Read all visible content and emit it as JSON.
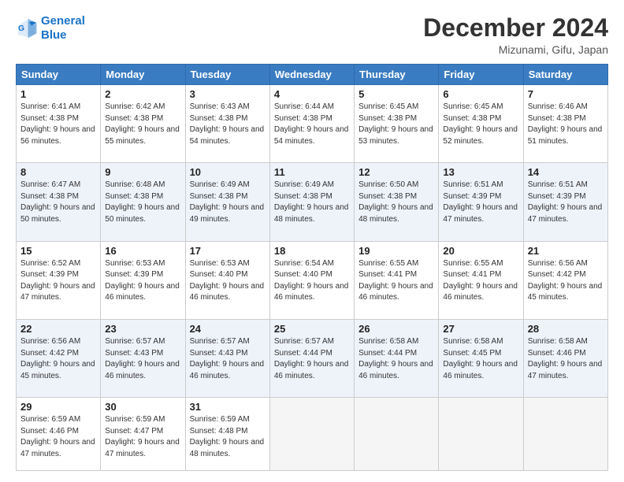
{
  "header": {
    "logo_line1": "General",
    "logo_line2": "Blue",
    "month_title": "December 2024",
    "location": "Mizunami, Gifu, Japan"
  },
  "weekdays": [
    "Sunday",
    "Monday",
    "Tuesday",
    "Wednesday",
    "Thursday",
    "Friday",
    "Saturday"
  ],
  "weeks": [
    [
      {
        "day": "1",
        "sunrise": "6:41 AM",
        "sunset": "4:38 PM",
        "daylight": "9 hours and 56 minutes."
      },
      {
        "day": "2",
        "sunrise": "6:42 AM",
        "sunset": "4:38 PM",
        "daylight": "9 hours and 55 minutes."
      },
      {
        "day": "3",
        "sunrise": "6:43 AM",
        "sunset": "4:38 PM",
        "daylight": "9 hours and 54 minutes."
      },
      {
        "day": "4",
        "sunrise": "6:44 AM",
        "sunset": "4:38 PM",
        "daylight": "9 hours and 54 minutes."
      },
      {
        "day": "5",
        "sunrise": "6:45 AM",
        "sunset": "4:38 PM",
        "daylight": "9 hours and 53 minutes."
      },
      {
        "day": "6",
        "sunrise": "6:45 AM",
        "sunset": "4:38 PM",
        "daylight": "9 hours and 52 minutes."
      },
      {
        "day": "7",
        "sunrise": "6:46 AM",
        "sunset": "4:38 PM",
        "daylight": "9 hours and 51 minutes."
      }
    ],
    [
      {
        "day": "8",
        "sunrise": "6:47 AM",
        "sunset": "4:38 PM",
        "daylight": "9 hours and 50 minutes."
      },
      {
        "day": "9",
        "sunrise": "6:48 AM",
        "sunset": "4:38 PM",
        "daylight": "9 hours and 50 minutes."
      },
      {
        "day": "10",
        "sunrise": "6:49 AM",
        "sunset": "4:38 PM",
        "daylight": "9 hours and 49 minutes."
      },
      {
        "day": "11",
        "sunrise": "6:49 AM",
        "sunset": "4:38 PM",
        "daylight": "9 hours and 48 minutes."
      },
      {
        "day": "12",
        "sunrise": "6:50 AM",
        "sunset": "4:38 PM",
        "daylight": "9 hours and 48 minutes."
      },
      {
        "day": "13",
        "sunrise": "6:51 AM",
        "sunset": "4:39 PM",
        "daylight": "9 hours and 47 minutes."
      },
      {
        "day": "14",
        "sunrise": "6:51 AM",
        "sunset": "4:39 PM",
        "daylight": "9 hours and 47 minutes."
      }
    ],
    [
      {
        "day": "15",
        "sunrise": "6:52 AM",
        "sunset": "4:39 PM",
        "daylight": "9 hours and 47 minutes."
      },
      {
        "day": "16",
        "sunrise": "6:53 AM",
        "sunset": "4:39 PM",
        "daylight": "9 hours and 46 minutes."
      },
      {
        "day": "17",
        "sunrise": "6:53 AM",
        "sunset": "4:40 PM",
        "daylight": "9 hours and 46 minutes."
      },
      {
        "day": "18",
        "sunrise": "6:54 AM",
        "sunset": "4:40 PM",
        "daylight": "9 hours and 46 minutes."
      },
      {
        "day": "19",
        "sunrise": "6:55 AM",
        "sunset": "4:41 PM",
        "daylight": "9 hours and 46 minutes."
      },
      {
        "day": "20",
        "sunrise": "6:55 AM",
        "sunset": "4:41 PM",
        "daylight": "9 hours and 46 minutes."
      },
      {
        "day": "21",
        "sunrise": "6:56 AM",
        "sunset": "4:42 PM",
        "daylight": "9 hours and 45 minutes."
      }
    ],
    [
      {
        "day": "22",
        "sunrise": "6:56 AM",
        "sunset": "4:42 PM",
        "daylight": "9 hours and 45 minutes."
      },
      {
        "day": "23",
        "sunrise": "6:57 AM",
        "sunset": "4:43 PM",
        "daylight": "9 hours and 46 minutes."
      },
      {
        "day": "24",
        "sunrise": "6:57 AM",
        "sunset": "4:43 PM",
        "daylight": "9 hours and 46 minutes."
      },
      {
        "day": "25",
        "sunrise": "6:57 AM",
        "sunset": "4:44 PM",
        "daylight": "9 hours and 46 minutes."
      },
      {
        "day": "26",
        "sunrise": "6:58 AM",
        "sunset": "4:44 PM",
        "daylight": "9 hours and 46 minutes."
      },
      {
        "day": "27",
        "sunrise": "6:58 AM",
        "sunset": "4:45 PM",
        "daylight": "9 hours and 46 minutes."
      },
      {
        "day": "28",
        "sunrise": "6:58 AM",
        "sunset": "4:46 PM",
        "daylight": "9 hours and 47 minutes."
      }
    ],
    [
      {
        "day": "29",
        "sunrise": "6:59 AM",
        "sunset": "4:46 PM",
        "daylight": "9 hours and 47 minutes."
      },
      {
        "day": "30",
        "sunrise": "6:59 AM",
        "sunset": "4:47 PM",
        "daylight": "9 hours and 47 minutes."
      },
      {
        "day": "31",
        "sunrise": "6:59 AM",
        "sunset": "4:48 PM",
        "daylight": "9 hours and 48 minutes."
      },
      null,
      null,
      null,
      null
    ]
  ]
}
